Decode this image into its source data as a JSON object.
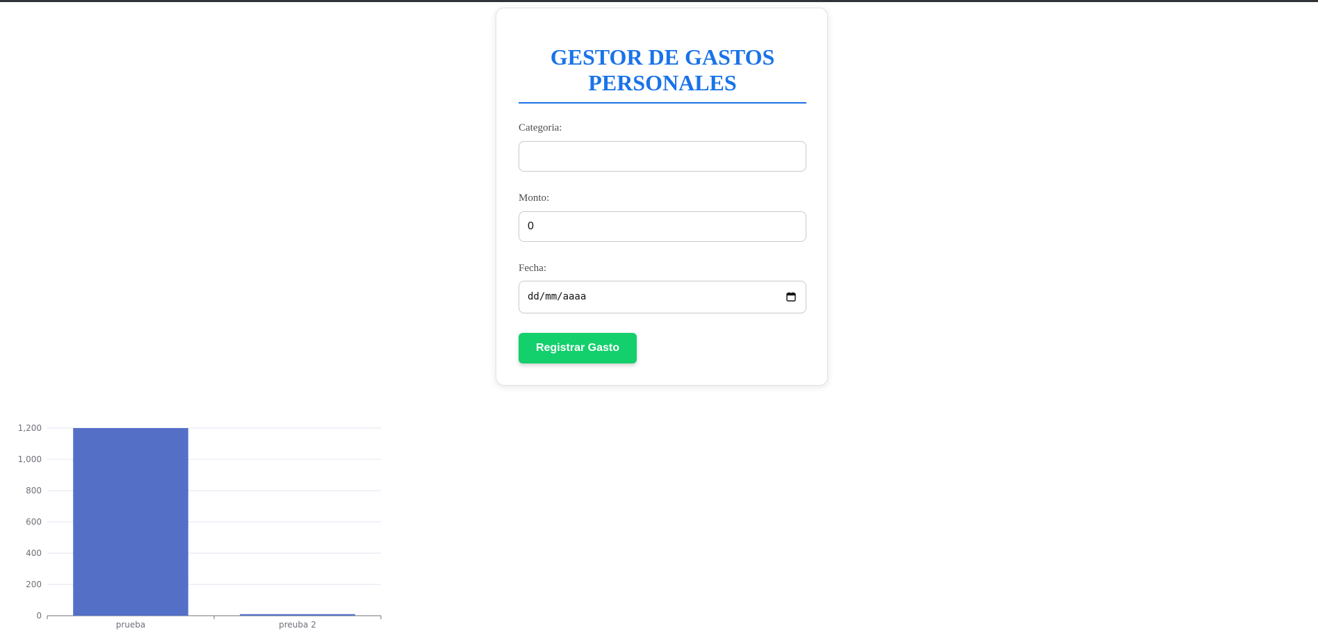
{
  "form": {
    "title": "GESTOR DE GASTOS PERSONALES",
    "title_line1": "GESTOR DE GASTOS",
    "title_line2": "PERSONALES",
    "category_label": "Categoria:",
    "category_value": "",
    "amount_label": "Monto:",
    "amount_value": "0",
    "date_label": "Fecha:",
    "date_placeholder": "dd/mm/aaaa",
    "submit_label": "Registrar Gasto"
  },
  "colors": {
    "title": "#1a73e8",
    "button": "#13cf6c",
    "bar": "#5470c6"
  },
  "chart_data": {
    "type": "bar",
    "categories": [
      "prueba",
      "preuba 2"
    ],
    "values": [
      1200,
      10
    ],
    "ylim": [
      0,
      1200
    ],
    "yticks": [
      0,
      200,
      400,
      600,
      800,
      1000,
      1200
    ],
    "ytick_labels": [
      "0",
      "200",
      "400",
      "600",
      "800",
      "1,000",
      "1,200"
    ],
    "grid": true,
    "title": "",
    "xlabel": "",
    "ylabel": ""
  }
}
